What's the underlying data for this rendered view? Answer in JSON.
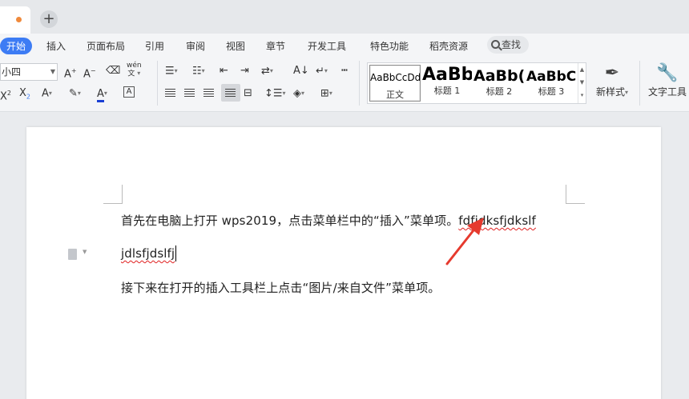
{
  "titlebar": {
    "new_tab_label": "+"
  },
  "menu": {
    "items": [
      "开始",
      "插入",
      "页面布局",
      "引用",
      "审阅",
      "视图",
      "章节",
      "开发工具",
      "特色功能",
      "稻壳资源"
    ],
    "search_label": "查找"
  },
  "font": {
    "size_value": "小四",
    "pinyin_label": "wén"
  },
  "styles": [
    {
      "preview": "AaBbCcDd",
      "name": "正文"
    },
    {
      "preview": "AaBb",
      "name": "标题 1"
    },
    {
      "preview": "AaBb(",
      "name": "标题 2"
    },
    {
      "preview": "AaBbC",
      "name": "标题 3"
    }
  ],
  "buttons": {
    "new_style": "新样式",
    "text_tools": "文字工具"
  },
  "document": {
    "para1_text": "首先在电脑上打开 wps2019，点击菜单栏中的“插入”菜单项。",
    "para1_typed": "fdfjdksfjdkslf",
    "para2_text": "jdlsfjdslfj",
    "para3_text": "接下来在打开的插入工具栏上点击“图片/来自文件”菜单项。"
  },
  "colors": {
    "accent": "#3d7cf4",
    "arrow": "#e63a2e",
    "tab_dot": "#f08a3c"
  }
}
